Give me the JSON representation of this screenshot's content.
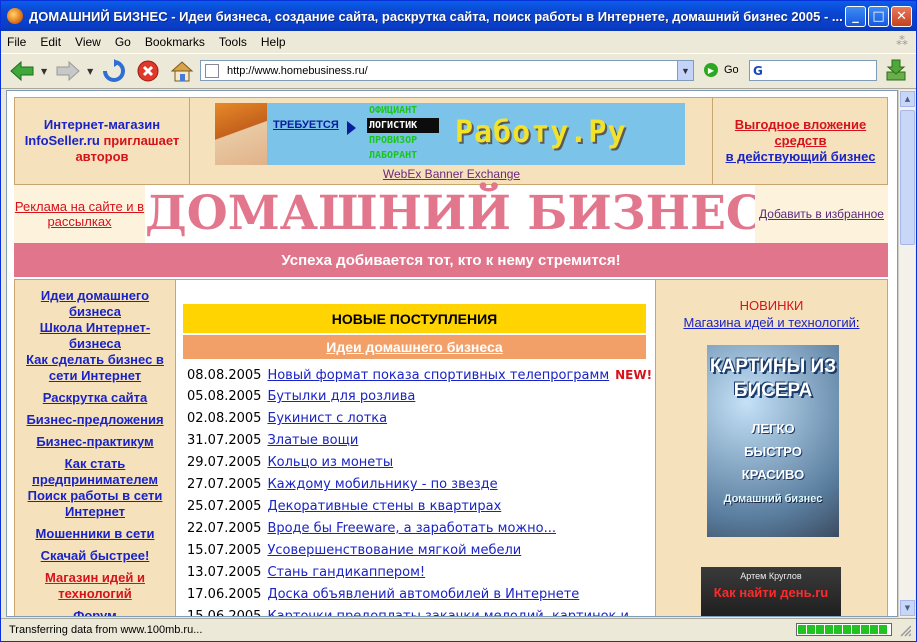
{
  "window": {
    "title": "ДОМАШНИЙ БИЗНЕС - Идеи бизнеса, создание сайта, раскрутка сайта, поиск работы в Интернете, домашний бизнес 2005 - ...",
    "minimize": "_",
    "maximize": "□",
    "close": "✕"
  },
  "menu": [
    "File",
    "Edit",
    "View",
    "Go",
    "Bookmarks",
    "Tools",
    "Help"
  ],
  "toolbar": {
    "url": "http://www.homebusiness.ru/",
    "go_label": "Go",
    "search_value": "G"
  },
  "status": {
    "text": "Transferring data from www.100mb.ru...",
    "progress": 1.0
  },
  "page": {
    "top_left": {
      "line1": "Интернет-магазин",
      "line2a": "InfoSeller.ru",
      "line2b": " приглашает",
      "line3": "авторов"
    },
    "banner": {
      "request": "ТРЕБУЕТСЯ",
      "options": [
        "ОФИЦИАНТ",
        "ЛОГИСТИК",
        "ПРОВИЗОР",
        "ЛАБОРАНТ"
      ],
      "logo": "Работу.Ру",
      "exchange": "WebEx Banner Exchange"
    },
    "top_right": {
      "line1": "Выгодное вложение",
      "line2": "средств",
      "line3": "в действующий бизнес"
    },
    "adv": "Реклама на сайте и в рассылках",
    "site_title": "ДОМАШНИЙ БИЗНЕС",
    "add_fav": "Добавить в избранное",
    "slogan": "Успеха добивается тот, кто к нему стремится!",
    "left_menu": [
      "Идеи домашнего бизнеса",
      "Школа Интернет-бизнеса",
      "Как сделать бизнес в сети Интернет",
      "Раскрутка сайта",
      "Бизнес-предложения",
      "Бизнес-практикум",
      "Как стать предпринимателем",
      "Поиск работы в сети Интернет",
      "Мошенники в сети",
      "Скачай быстрее!",
      "Магазин идей и технологий",
      "Форум"
    ],
    "news_header": "НОВЫЕ ПОСТУПЛЕНИЯ",
    "news_sub": "Идеи домашнего бизнеса",
    "new_badge": "NEW!",
    "news": [
      {
        "date": "08.08.2005",
        "title": "Новый формат показа спортивных телепрограмм"
      },
      {
        "date": "05.08.2005",
        "title": "Бутылки для розлива"
      },
      {
        "date": "02.08.2005",
        "title": "Букинист с лотка"
      },
      {
        "date": "31.07.2005",
        "title": "Златые вощи"
      },
      {
        "date": "29.07.2005",
        "title": "Кольцо из монеты"
      },
      {
        "date": "27.07.2005",
        "title": "Каждому мобильнику - по звезде"
      },
      {
        "date": "25.07.2005",
        "title": "Декоративные стены в квартирах"
      },
      {
        "date": "22.07.2005",
        "title": "Вроде бы Freeware, а заработать можно..."
      },
      {
        "date": "15.07.2005",
        "title": "Усовершенствование мягкой мебели"
      },
      {
        "date": "13.07.2005",
        "title": "Стань гандикаппером!"
      },
      {
        "date": "17.06.2005",
        "title": "Доска объявлений автомобилей в Интернете"
      },
      {
        "date": "15.06.2005",
        "title": "Карточки предоплаты закачки мелодий, картинок и"
      }
    ],
    "right": {
      "title": "НОВИНКИ",
      "subtitle": "Магазина идей и технологий",
      "colon": ":",
      "book1_title": "КАРТИНЫ ИЗ БИСЕРА",
      "book1_lines": [
        "ЛЕГКО",
        "БЫСТРО",
        "КРАСИВО"
      ],
      "book1_bottom": "Домашний бизнес",
      "book2_author": "Артем Круглов",
      "book2_title": "Как найти день.ru"
    }
  }
}
